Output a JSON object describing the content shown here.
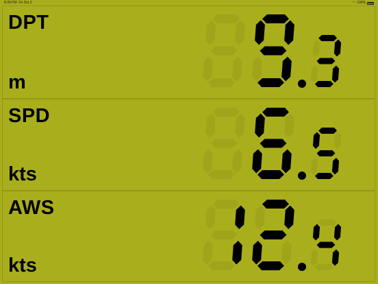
{
  "status_bar": {
    "time": "8:39 PM",
    "date": "Fri Oct 2",
    "battery": "100%",
    "wifi_icon": "wifi-icon",
    "battery_icon": "battery-icon"
  },
  "colors": {
    "background": "#a9ae1c",
    "segment_on": "#000000",
    "segment_off": "#9fa41a",
    "panel_border": "#93981a"
  },
  "panels": [
    {
      "label": "DPT",
      "unit": "m",
      "value": "9.3",
      "digits": [
        "",
        "9",
        "3"
      ]
    },
    {
      "label": "SPD",
      "unit": "kts",
      "value": "6.5",
      "digits": [
        "",
        "6",
        "5"
      ]
    },
    {
      "label": "AWS",
      "unit": "kts",
      "value": "12.4",
      "digits": [
        "1",
        "2",
        "4"
      ]
    }
  ]
}
